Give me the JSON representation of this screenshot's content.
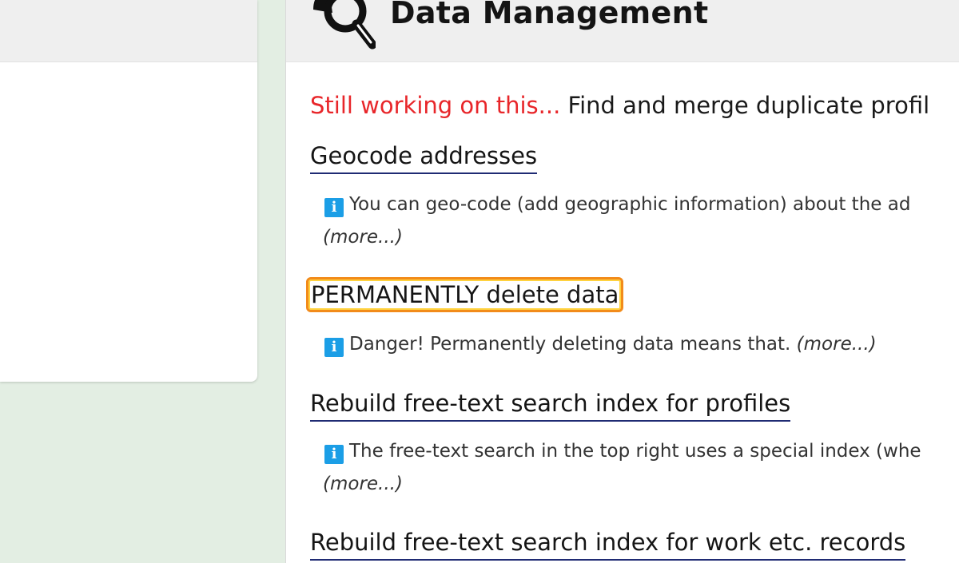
{
  "header": {
    "title": "Data Management",
    "icon": "magnifier-database-icon"
  },
  "notice": {
    "warning": "Still working on this...",
    "text": "Find and merge duplicate profil"
  },
  "sections": [
    {
      "title": "Geocode addresses",
      "info": "You can geo-code (add geographic information) about the ad",
      "more": "(more...)"
    },
    {
      "title": "PERMANENTLY delete data",
      "info": "Danger! Permanently deleting data means that.",
      "more": "(more...)"
    },
    {
      "title": "Rebuild free-text search index for profiles",
      "info": "The free-text search in the top right uses a special index (whe",
      "more": "(more...)"
    },
    {
      "title": "Rebuild free-text search index for work etc. records"
    }
  ],
  "colors": {
    "warning": "#e8262a",
    "link_underline": "#1f2b73",
    "info_icon": "#1b9ee6",
    "highlight": "#f28b1a"
  }
}
